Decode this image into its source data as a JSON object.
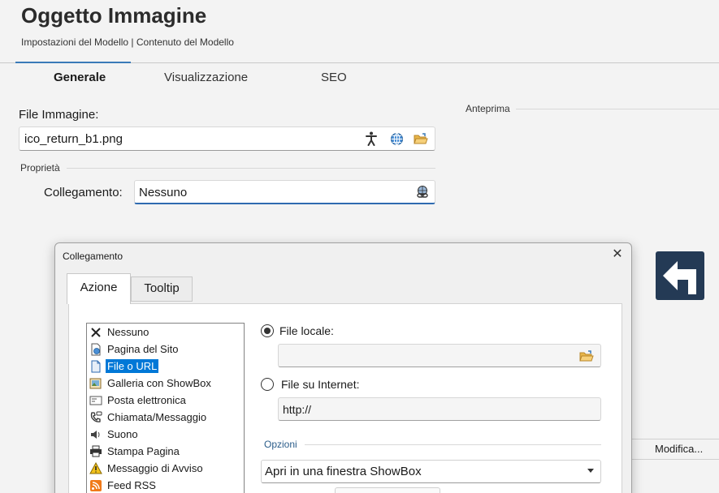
{
  "header": {
    "title": "Oggetto Immagine",
    "subtitle": "Impostazioni del Modello | Contenuto del Modello"
  },
  "tabs": [
    {
      "label": "Generale",
      "active": true
    },
    {
      "label": "Visualizzazione",
      "active": false
    },
    {
      "label": "SEO",
      "active": false
    }
  ],
  "file_field": {
    "label": "File Immagine:",
    "value": "ico_return_b1.png",
    "icons": [
      "accessibility-icon",
      "globe-icon",
      "open-folder-icon"
    ]
  },
  "preview": {
    "label": "Anteprima",
    "image": "return-arrow-icon"
  },
  "properties": {
    "section_label": "Proprietà",
    "link_label": "Collegamento:",
    "link_value": "Nessuno"
  },
  "side_panel": {
    "edit_label": "Modifica..."
  },
  "dialog": {
    "title": "Collegamento",
    "close": "✕",
    "tabs": [
      {
        "label": "Azione",
        "active": true
      },
      {
        "label": "Tooltip",
        "active": false
      }
    ],
    "link_types": [
      {
        "label": "Nessuno",
        "icon": "x-icon",
        "selected": false
      },
      {
        "label": "Pagina del Sito",
        "icon": "page-globe-icon",
        "selected": false
      },
      {
        "label": "File o URL",
        "icon": "file-icon",
        "selected": true
      },
      {
        "label": "Galleria con ShowBox",
        "icon": "gallery-icon",
        "selected": false
      },
      {
        "label": "Posta elettronica",
        "icon": "envelope-icon",
        "selected": false
      },
      {
        "label": "Chiamata/Messaggio",
        "icon": "phone-icon",
        "selected": false
      },
      {
        "label": "Suono",
        "icon": "speaker-icon",
        "selected": false
      },
      {
        "label": "Stampa Pagina",
        "icon": "printer-icon",
        "selected": false
      },
      {
        "label": "Messaggio di Avviso",
        "icon": "warning-icon",
        "selected": false
      },
      {
        "label": "Feed RSS",
        "icon": "rss-icon",
        "selected": false
      }
    ],
    "local_file": {
      "label": "File locale:",
      "value": "",
      "selected": true
    },
    "internet_file": {
      "label": "File su Internet:",
      "value": "http://",
      "selected": false
    },
    "options": {
      "label": "Opzioni",
      "open_mode": "Apri in una finestra ShowBox"
    }
  },
  "colors": {
    "accent": "#3a7ab8",
    "selection": "#0078d7",
    "preview_bg": "#243a55"
  }
}
